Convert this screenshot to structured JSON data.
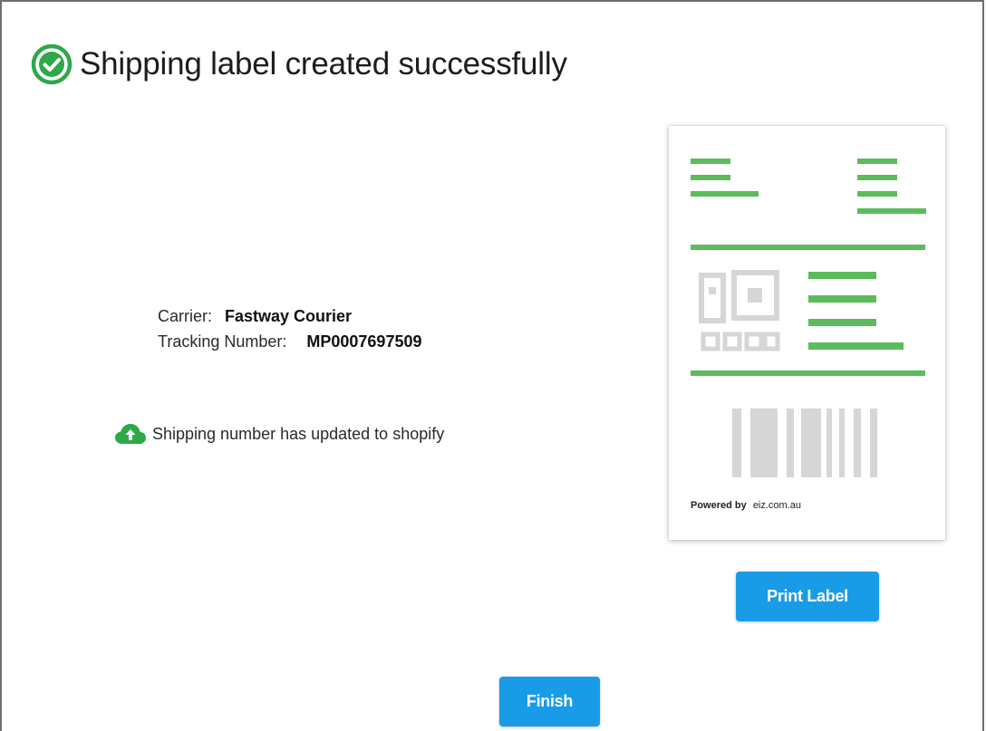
{
  "header": {
    "title": "Shipping label created successfully",
    "icon": "check-circle-icon"
  },
  "shipment": {
    "carrier_label": "Carrier:",
    "carrier_value": "Fastway Courier",
    "tracking_label": "Tracking Number:",
    "tracking_value": "MP0007697509"
  },
  "sync": {
    "icon": "cloud-upload-icon",
    "message": "Shipping number has updated to shopify"
  },
  "label_preview": {
    "powered_by": "Powered by",
    "site": "eiz.com.au"
  },
  "actions": {
    "print_label": "Print Label",
    "finish": "Finish"
  },
  "colors": {
    "success_green": "#2ea84a",
    "accent_blue": "#1a9be8",
    "label_green": "#5cbc5c",
    "label_gray": "#d9d9d9"
  }
}
